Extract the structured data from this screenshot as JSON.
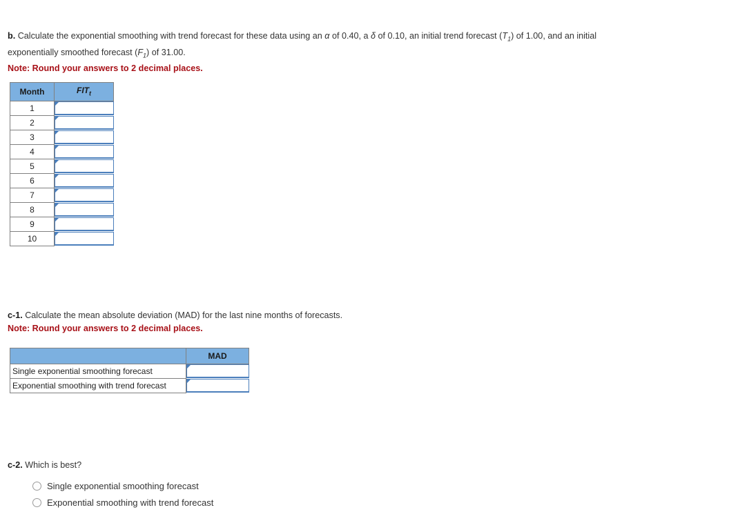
{
  "question_b": {
    "lead": "b.",
    "text_part1": " Calculate the exponential smoothing with trend forecast for these data using an ",
    "alpha_symbol": "α",
    "text_part2": " of 0.40, a ",
    "delta_symbol": "δ",
    "text_part3": " of 0.10, an initial trend forecast (",
    "T_var": "T",
    "T_sub": "1",
    "text_part4": ") of 1.00, and an initial exponentially smoothed forecast (",
    "F_var": "F",
    "F_sub": "1",
    "text_part5": ") of 31.00.",
    "note": "Note: Round your answers to 2 decimal places."
  },
  "fit_table": {
    "headers": {
      "month": "Month",
      "fit_var": "FIT",
      "fit_sub": "t"
    },
    "rows": [
      {
        "month": "1",
        "fit": ""
      },
      {
        "month": "2",
        "fit": ""
      },
      {
        "month": "3",
        "fit": ""
      },
      {
        "month": "4",
        "fit": ""
      },
      {
        "month": "5",
        "fit": ""
      },
      {
        "month": "6",
        "fit": ""
      },
      {
        "month": "7",
        "fit": ""
      },
      {
        "month": "8",
        "fit": ""
      },
      {
        "month": "9",
        "fit": ""
      },
      {
        "month": "10",
        "fit": ""
      }
    ]
  },
  "question_c1": {
    "lead": "c-1.",
    "text": " Calculate the mean absolute deviation (MAD) for the last nine months of forecasts.",
    "note": "Note: Round your answers to 2 decimal places."
  },
  "mad_table": {
    "headers": {
      "label": "",
      "mad": "MAD"
    },
    "rows": [
      {
        "label": "Single exponential smoothing forecast",
        "mad": ""
      },
      {
        "label": "Exponential smoothing with trend forecast",
        "mad": ""
      }
    ]
  },
  "question_c2": {
    "lead": "c-2.",
    "text": " Which is best?",
    "options": [
      {
        "label": "Single exponential smoothing forecast",
        "selected": false
      },
      {
        "label": "Exponential smoothing with trend forecast",
        "selected": false
      }
    ]
  },
  "colors": {
    "header_blue": "#7cb0e0",
    "input_border_blue": "#4a7ebb",
    "note_red": "#a81118",
    "grid_gray": "#808080",
    "text": "#333333"
  }
}
